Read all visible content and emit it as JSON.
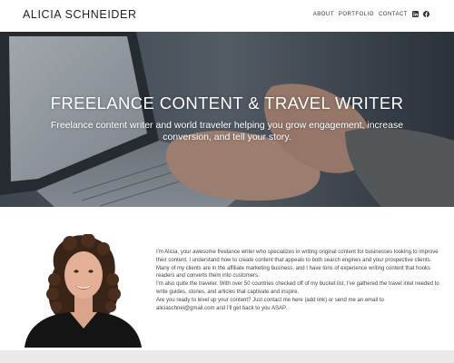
{
  "header": {
    "site_title": "ALICIA SCHNEIDER",
    "nav": [
      {
        "label": "ABOUT"
      },
      {
        "label": "PORTFOLIO"
      },
      {
        "label": "CONTACT"
      }
    ],
    "social_icons": [
      "linkedin-icon",
      "facebook-icon"
    ]
  },
  "hero": {
    "title": "FREELANCE CONTENT & TRAVEL WRITER",
    "subtitle_line1": "Freelance content writer and world traveler helping you grow engagement, increase",
    "subtitle_line2": "conversion, and tell your story."
  },
  "about": {
    "paragraph1": "I'm Alicia, your awesome freelance writer who specializes in writing original content for businesses looking to improve their content. I understand how to create content that appeals to both search engines and your prospective clients.",
    "paragraph2": "Many of my clients are in the affiliate marketing business, and I have tons of experience writing content that hooks readers and converts them into customers.",
    "paragraph3": "I'm also quite the traveler. With over 50 countries checked off of my bucket list, I've gathered the travel intel needed to write guides, stories, and articles that captivate and inspire.",
    "paragraph4_start": "Are you ready to level up your content? Just contact me here ",
    "paragraph4_link": "(add link)",
    "paragraph4_middle": " or send me an email to ",
    "paragraph4_email": "aliciaschnei@gmail.com",
    "paragraph4_end": " and I'll get back to you ASAP."
  },
  "colors": {
    "hero_overlay": "#3d4650",
    "footer_band": "#eaeaea",
    "text": "#444444"
  }
}
